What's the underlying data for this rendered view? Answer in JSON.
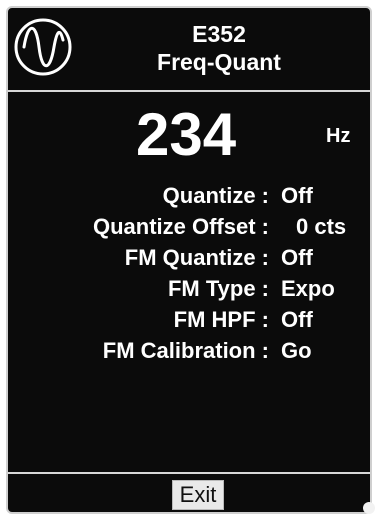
{
  "header": {
    "model": "E352",
    "name": "Freq-Quant",
    "logo_icon": "sine-wave-icon"
  },
  "frequency": {
    "value": "234",
    "unit": "Hz"
  },
  "params": [
    {
      "label": "Quantize :",
      "value": "Off"
    },
    {
      "label": "Quantize Offset :",
      "value": "0 cts"
    },
    {
      "label": "FM Quantize :",
      "value": "Off"
    },
    {
      "label": "FM Type :",
      "value": "Expo"
    },
    {
      "label": "FM HPF :",
      "value": "Off"
    },
    {
      "label": "FM Calibration :",
      "value": "Go"
    }
  ],
  "footer": {
    "exit_label": "Exit"
  }
}
